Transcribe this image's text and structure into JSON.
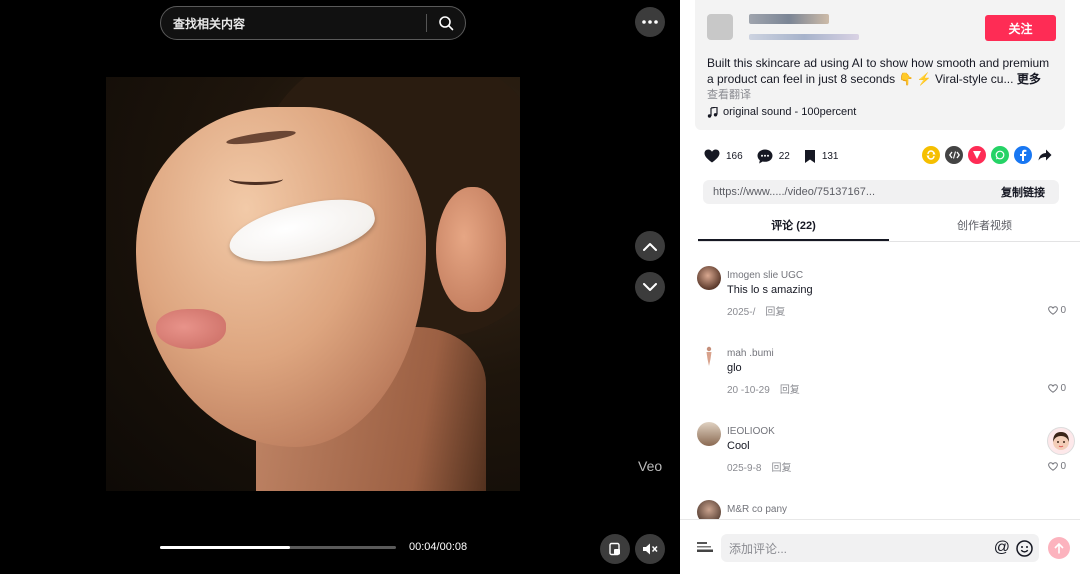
{
  "player": {
    "search_query": "查找相关内容",
    "watermark": "Veo",
    "time": "00:04/00:08",
    "progress": 0.55
  },
  "post": {
    "follow_label": "关注",
    "description": "Built this skincare ad using AI to show how smooth and premium a product can feel in just 8 seconds 👇 ⚡ Viral-style cu...",
    "more_label": "更多",
    "translate_label": "查看翻译",
    "sound": "original sound - 100percent",
    "likes": "166",
    "comments_count": "22",
    "saves": "131",
    "link": "https://www...../video/75137167...",
    "copy_link_label": "复制链接"
  },
  "tabs": [
    {
      "label": "评论 (22)",
      "active": true
    },
    {
      "label": "创作者视频",
      "active": false
    }
  ],
  "comments": [
    {
      "user": "Imogen  slie UGC",
      "text": "This lo  s amazing",
      "date": "2025-/",
      "reply": "回复",
      "likes": "0"
    },
    {
      "user": "mah   .bumi",
      "text": "glo",
      "date": "20  -10-29",
      "reply": "回复",
      "likes": "0"
    },
    {
      "user": "IEOLIOOK",
      "text": "Cool",
      "date": "025-9-8",
      "reply": "回复",
      "likes": "0"
    },
    {
      "user": "M&R co   pany",
      "text": "",
      "date": "",
      "reply": "",
      "likes": ""
    }
  ],
  "composer": {
    "placeholder": "添加评论...",
    "at_symbol": "@"
  },
  "colors": {
    "follow": "#fe2c55",
    "player_bg": "#000000",
    "send_disabled": "#fcb3be"
  }
}
